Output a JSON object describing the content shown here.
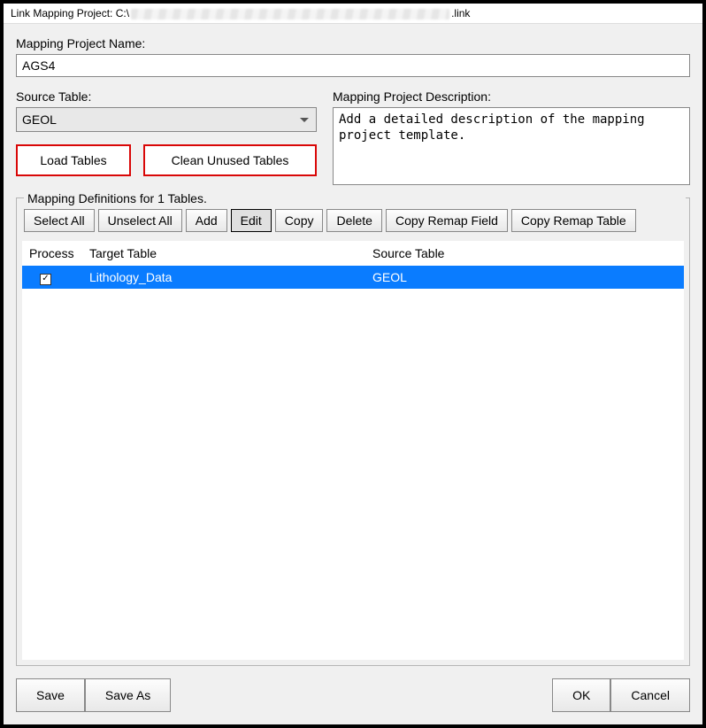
{
  "window": {
    "title_prefix": "Link Mapping Project: C:\\",
    "title_suffix": ".link"
  },
  "labels": {
    "project_name": "Mapping Project Name:",
    "source_table": "Source Table:",
    "description": "Mapping Project Description:",
    "fieldset": "Mapping Definitions for 1 Tables."
  },
  "project": {
    "name": "AGS4",
    "source_table": "GEOL",
    "description": "Add a detailed description of the mapping project template."
  },
  "buttons": {
    "load_tables": "Load Tables",
    "clean_unused": "Clean Unused Tables",
    "select_all": "Select All",
    "unselect_all": "Unselect All",
    "add": "Add",
    "edit": "Edit",
    "copy": "Copy",
    "delete": "Delete",
    "copy_remap_field": "Copy Remap Field",
    "copy_remap_table": "Copy Remap Table",
    "save": "Save",
    "save_as": "Save As",
    "ok": "OK",
    "cancel": "Cancel"
  },
  "table": {
    "headers": {
      "process": "Process",
      "target": "Target Table",
      "source": "Source Table"
    },
    "rows": [
      {
        "process_checked": true,
        "target": "Lithology_Data",
        "source": "GEOL"
      }
    ]
  }
}
